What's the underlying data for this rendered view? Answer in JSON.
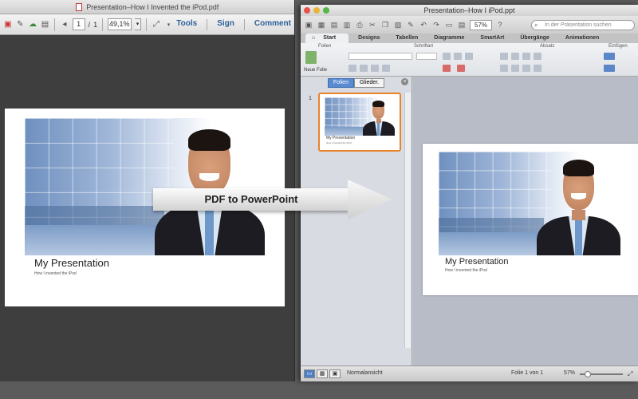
{
  "pdf": {
    "window_title": "Presentation–How I Invented the iPod.pdf",
    "page_current": "1",
    "page_sep": "/",
    "page_total": "1",
    "zoom": "49,1%",
    "tools": "Tools",
    "sign": "Sign",
    "comment": "Comment",
    "slide_title": "My Presentation",
    "slide_subtitle": "How I invented the iPod"
  },
  "arrow_label": "PDF to PowerPoint",
  "ppt": {
    "window_title": "Presentation–How I iPod.ppt",
    "zoom": "57%",
    "search_placeholder": "In der Präsentation suchen",
    "tabs": [
      "Start",
      "Designs",
      "Tabellen",
      "Diagramme",
      "SmartArt",
      "Übergänge",
      "Animationen"
    ],
    "groups": [
      "Folien",
      "Schriftart",
      "Absatz",
      "Einfügen"
    ],
    "new_slide": "Neue Folie",
    "sidebar_tabs": [
      "Folien",
      "Glieder."
    ],
    "slide_number": "1",
    "slide_title": "My Presentation",
    "slide_subtitle": "How I invented the iPod",
    "status_view": "Normalansicht",
    "status_slide": "Folie 1 von 1",
    "status_zoom": "57%"
  },
  "colors": {
    "accent_orange": "#e8832a",
    "link_blue": "#2f5f9a",
    "tab_active_blue": "#5a8bd0"
  }
}
